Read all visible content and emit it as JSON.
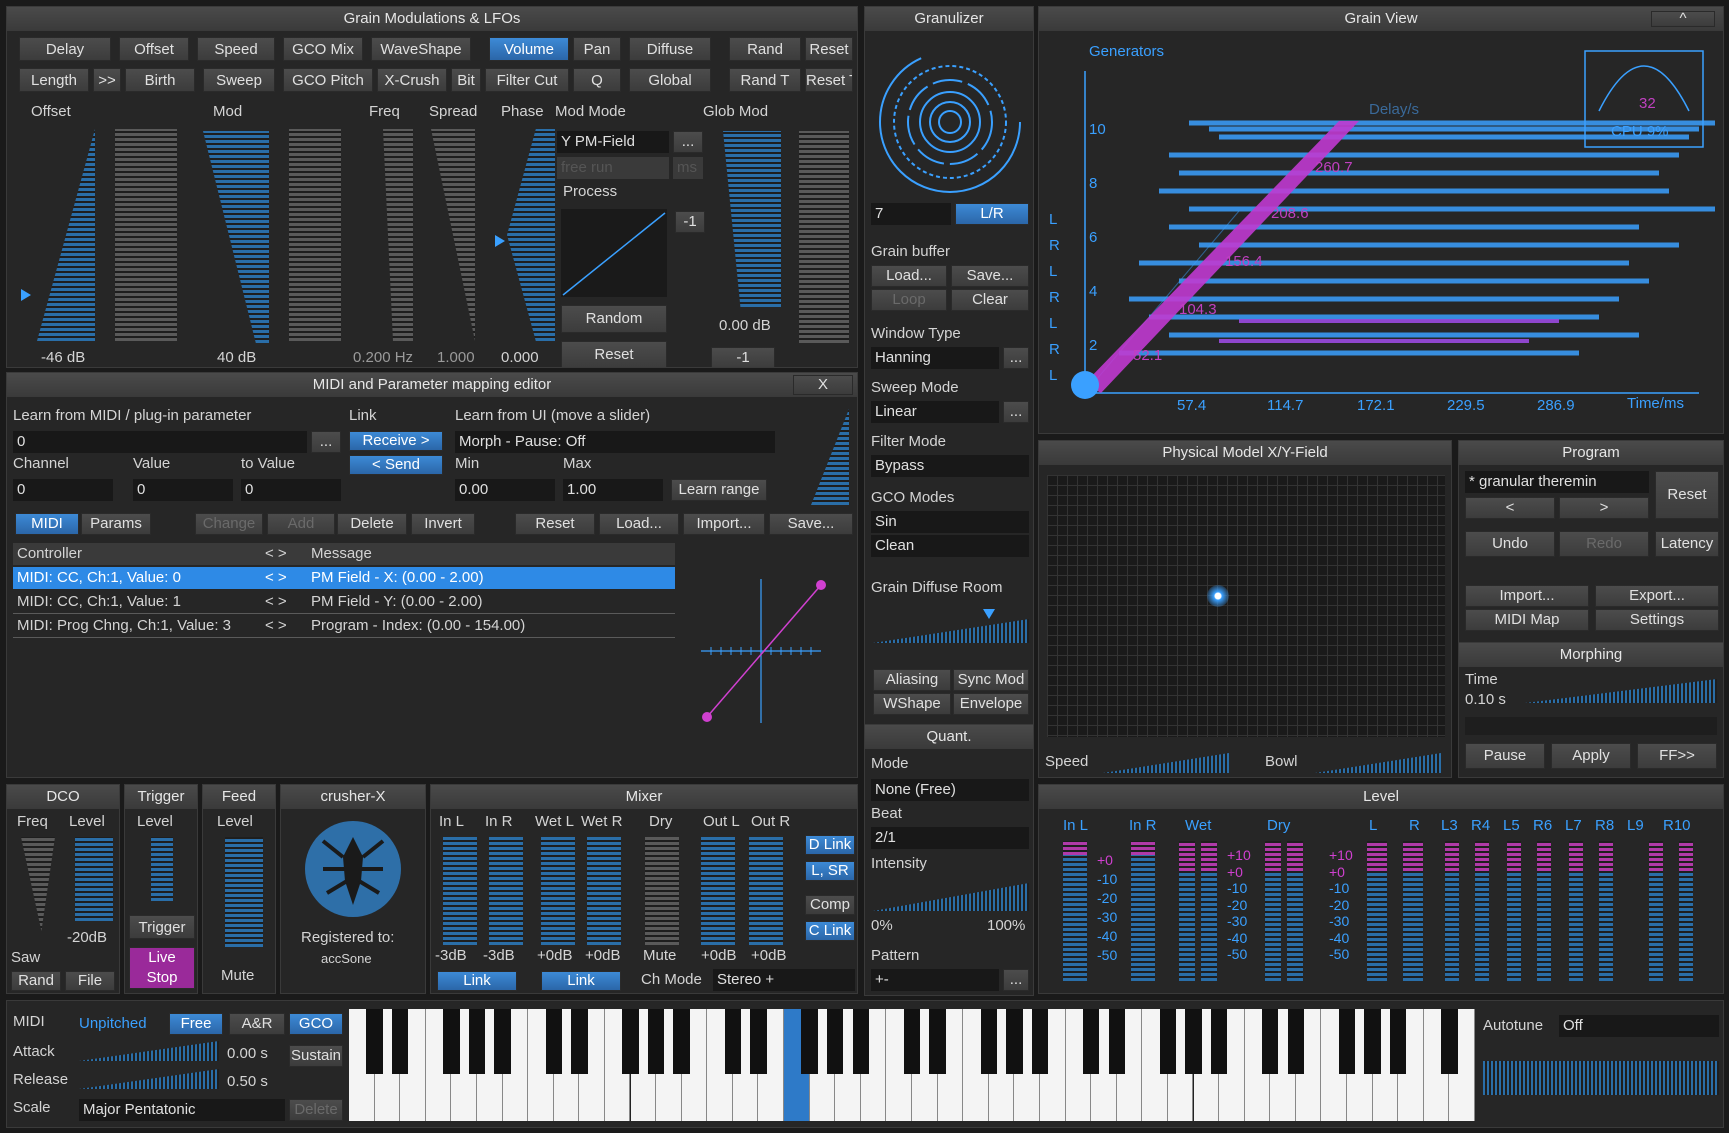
{
  "grain_mod": {
    "title": "Grain Modulations & LFOs",
    "row1": [
      "Delay",
      "Offset",
      "Speed",
      "GCO Mix",
      "WaveShape",
      "Volume",
      "Pan",
      "Diffuse",
      "Rand",
      "Reset"
    ],
    "row2": [
      "Length",
      ">>",
      "Birth",
      "Sweep",
      "GCO Pitch",
      "X-Crush",
      "Bit",
      "Filter Cut",
      "Q",
      "Global",
      "Rand T",
      "Reset T"
    ],
    "col_labels": [
      "Offset",
      "Mod",
      "Freq",
      "Spread",
      "Phase",
      "Mod Mode",
      "Glob Mod"
    ],
    "offset_value": "-46 dB",
    "mod_value": "40 dB",
    "freq_value": "0.200 Hz",
    "spread_value": "1.000",
    "phase_value": "0.000",
    "mod_mode": "Y PM-Field",
    "free_run": "free run",
    "free_run_unit": "ms",
    "more": "...",
    "process_label": "Process",
    "process_btn": "-1",
    "random_btn": "Random",
    "reset_btn": "Reset",
    "glob_value": "0.00 dB",
    "glob_btn": "-1"
  },
  "granulizer": {
    "title": "Granulizer",
    "voices": "7",
    "lr_btn": "L/R",
    "grain_buffer": "Grain buffer",
    "load": "Load...",
    "save": "Save...",
    "loop": "Loop",
    "clear": "Clear",
    "window_type_label": "Window Type",
    "window_type": "Hanning",
    "sweep_mode_label": "Sweep Mode",
    "sweep_mode": "Linear",
    "filter_mode_label": "Filter Mode",
    "filter_mode": "Bypass",
    "gco_modes_label": "GCO Modes",
    "gco_mode1": "Sin",
    "gco_mode2": "Clean",
    "diffuse_room_label": "Grain Diffuse Room",
    "aliasing": "Aliasing",
    "sync_mod": "Sync Mod",
    "wshape": "WShape",
    "envelope": "Envelope",
    "more": "..."
  },
  "quant": {
    "title": "Quant.",
    "mode_label": "Mode",
    "mode": "None (Free)",
    "beat_label": "Beat",
    "beat": "2/1",
    "intensity_label": "Intensity",
    "intensity_min": "0%",
    "intensity_max": "100%",
    "pattern_label": "Pattern",
    "pattern": "+-",
    "more": "..."
  },
  "grain_view": {
    "title": "Grain View",
    "collapse": "^",
    "generators": "Generators",
    "delay_label": "Delay/s",
    "cpu": "CPU 9%",
    "cpu_num": "32",
    "y_ticks": [
      "10",
      "8",
      "6",
      "4",
      "2"
    ],
    "x_ticks": [
      "57.4",
      "114.7",
      "172.1",
      "229.5",
      "286.9"
    ],
    "x_axis_label": "Time/ms",
    "channels": [
      "L",
      "R",
      "L",
      "R",
      "L",
      "R",
      "L"
    ],
    "grain_labels": [
      "260.7",
      "208.6",
      "156.4",
      "104.3",
      "52.1"
    ]
  },
  "midi_map": {
    "title": "MIDI and Parameter mapping editor",
    "close": "X",
    "learn_midi_label": "Learn from MIDI / plug-in parameter",
    "learn_midi_value": "0",
    "more": "...",
    "link_label": "Link",
    "receive": "Receive >",
    "send": "< Send",
    "learn_ui_label": "Learn from UI (move a slider)",
    "learn_ui_value": "Morph - Pause: Off",
    "channel_label": "Channel",
    "channel_value": "0",
    "value_label": "Value",
    "value_value": "0",
    "to_value_label": "to Value",
    "to_value_value": "0",
    "min_label": "Min",
    "min_value": "0.00",
    "max_label": "Max",
    "max_value": "1.00",
    "learn_range": "Learn range",
    "tab_midi": "MIDI",
    "tab_params": "Params",
    "change": "Change",
    "add": "Add",
    "delete": "Delete",
    "invert": "Invert",
    "reset": "Reset",
    "load": "Load...",
    "import": "Import...",
    "save": "Save...",
    "col_controller": "Controller",
    "col_arrows": "< >",
    "col_message": "Message",
    "rows": [
      {
        "controller": "MIDI: CC, Ch:1, Value: 0",
        "arrows": "< >",
        "message": "PM Field - X: (0.00 - 2.00)"
      },
      {
        "controller": "MIDI: CC, Ch:1, Value: 1",
        "arrows": "< >",
        "message": "PM Field - Y: (0.00 - 2.00)"
      },
      {
        "controller": "MIDI: Prog Chng, Ch:1, Value: 3",
        "arrows": "< >",
        "message": "Program - Index: (0.00 - 154.00)"
      }
    ]
  },
  "pm_field": {
    "title": "Physical Model X/Y-Field",
    "speed": "Speed",
    "bowl": "Bowl"
  },
  "program": {
    "title": "Program",
    "name": "* granular theremin",
    "reset": "Reset",
    "prev": "<",
    "next": ">",
    "undo": "Undo",
    "redo": "Redo",
    "latency": "Latency",
    "import": "Import...",
    "export": "Export...",
    "midi_map": "MIDI Map",
    "settings": "Settings"
  },
  "morphing": {
    "title": "Morphing",
    "time_label": "Time",
    "time_value": "0.10 s",
    "pause": "Pause",
    "apply": "Apply",
    "ff": "FF>>"
  },
  "dco": {
    "title": "DCO",
    "freq": "Freq",
    "level": "Level",
    "level_value": "-20dB",
    "wave": "Saw",
    "rand": "Rand",
    "file": "File"
  },
  "trigger": {
    "title": "Trigger",
    "level": "Level",
    "btn": "Trigger",
    "live1": "Live",
    "live2": "Stop"
  },
  "feed": {
    "title": "Feed",
    "level": "Level",
    "mute": "Mute"
  },
  "crusher": {
    "title": "crusher-X",
    "registered": "Registered to:",
    "user": "accSone"
  },
  "mixer": {
    "title": "Mixer",
    "labels": [
      "In L",
      "In R",
      "Wet L",
      "Wet R",
      "Dry",
      "Out L",
      "Out R"
    ],
    "values": [
      "-3dB",
      "-3dB",
      "+0dB",
      "+0dB",
      "Mute",
      "+0dB",
      "+0dB"
    ],
    "link1": "Link",
    "link2": "Link",
    "ch_mode_label": "Ch Mode",
    "ch_mode": "Stereo +",
    "d_link": "D Link",
    "l_sr": "L, SR",
    "comp": "Comp",
    "c_link": "C Link"
  },
  "level": {
    "title": "Level",
    "groups": [
      "In L",
      "In R",
      "Wet",
      "Dry",
      "L",
      "R",
      "L3",
      "R4",
      "L5",
      "R6",
      "L7",
      "R8",
      "L9",
      "R10"
    ],
    "scale": [
      "+0",
      "-10",
      "-20",
      "-30",
      "-40",
      "-50"
    ],
    "scale2": [
      "+10",
      "+0",
      "-10",
      "-20",
      "-30",
      "-40",
      "-50"
    ]
  },
  "keyboard": {
    "midi_label": "MIDI",
    "unpitched": "Unpitched",
    "free": "Free",
    "ar": "A&R",
    "gco": "GCO",
    "attack_label": "Attack",
    "attack_value": "0.00 s",
    "sustain": "Sustain",
    "release_label": "Release",
    "release_value": "0.50 s",
    "scale_label": "Scale",
    "scale_value": "Major Pentatonic",
    "delete": "Delete",
    "autotune_label": "Autotune",
    "autotune_value": "Off"
  },
  "colors": {
    "accent": "#3aa0ff",
    "magenta": "#d040d0",
    "panel": "#262626"
  }
}
